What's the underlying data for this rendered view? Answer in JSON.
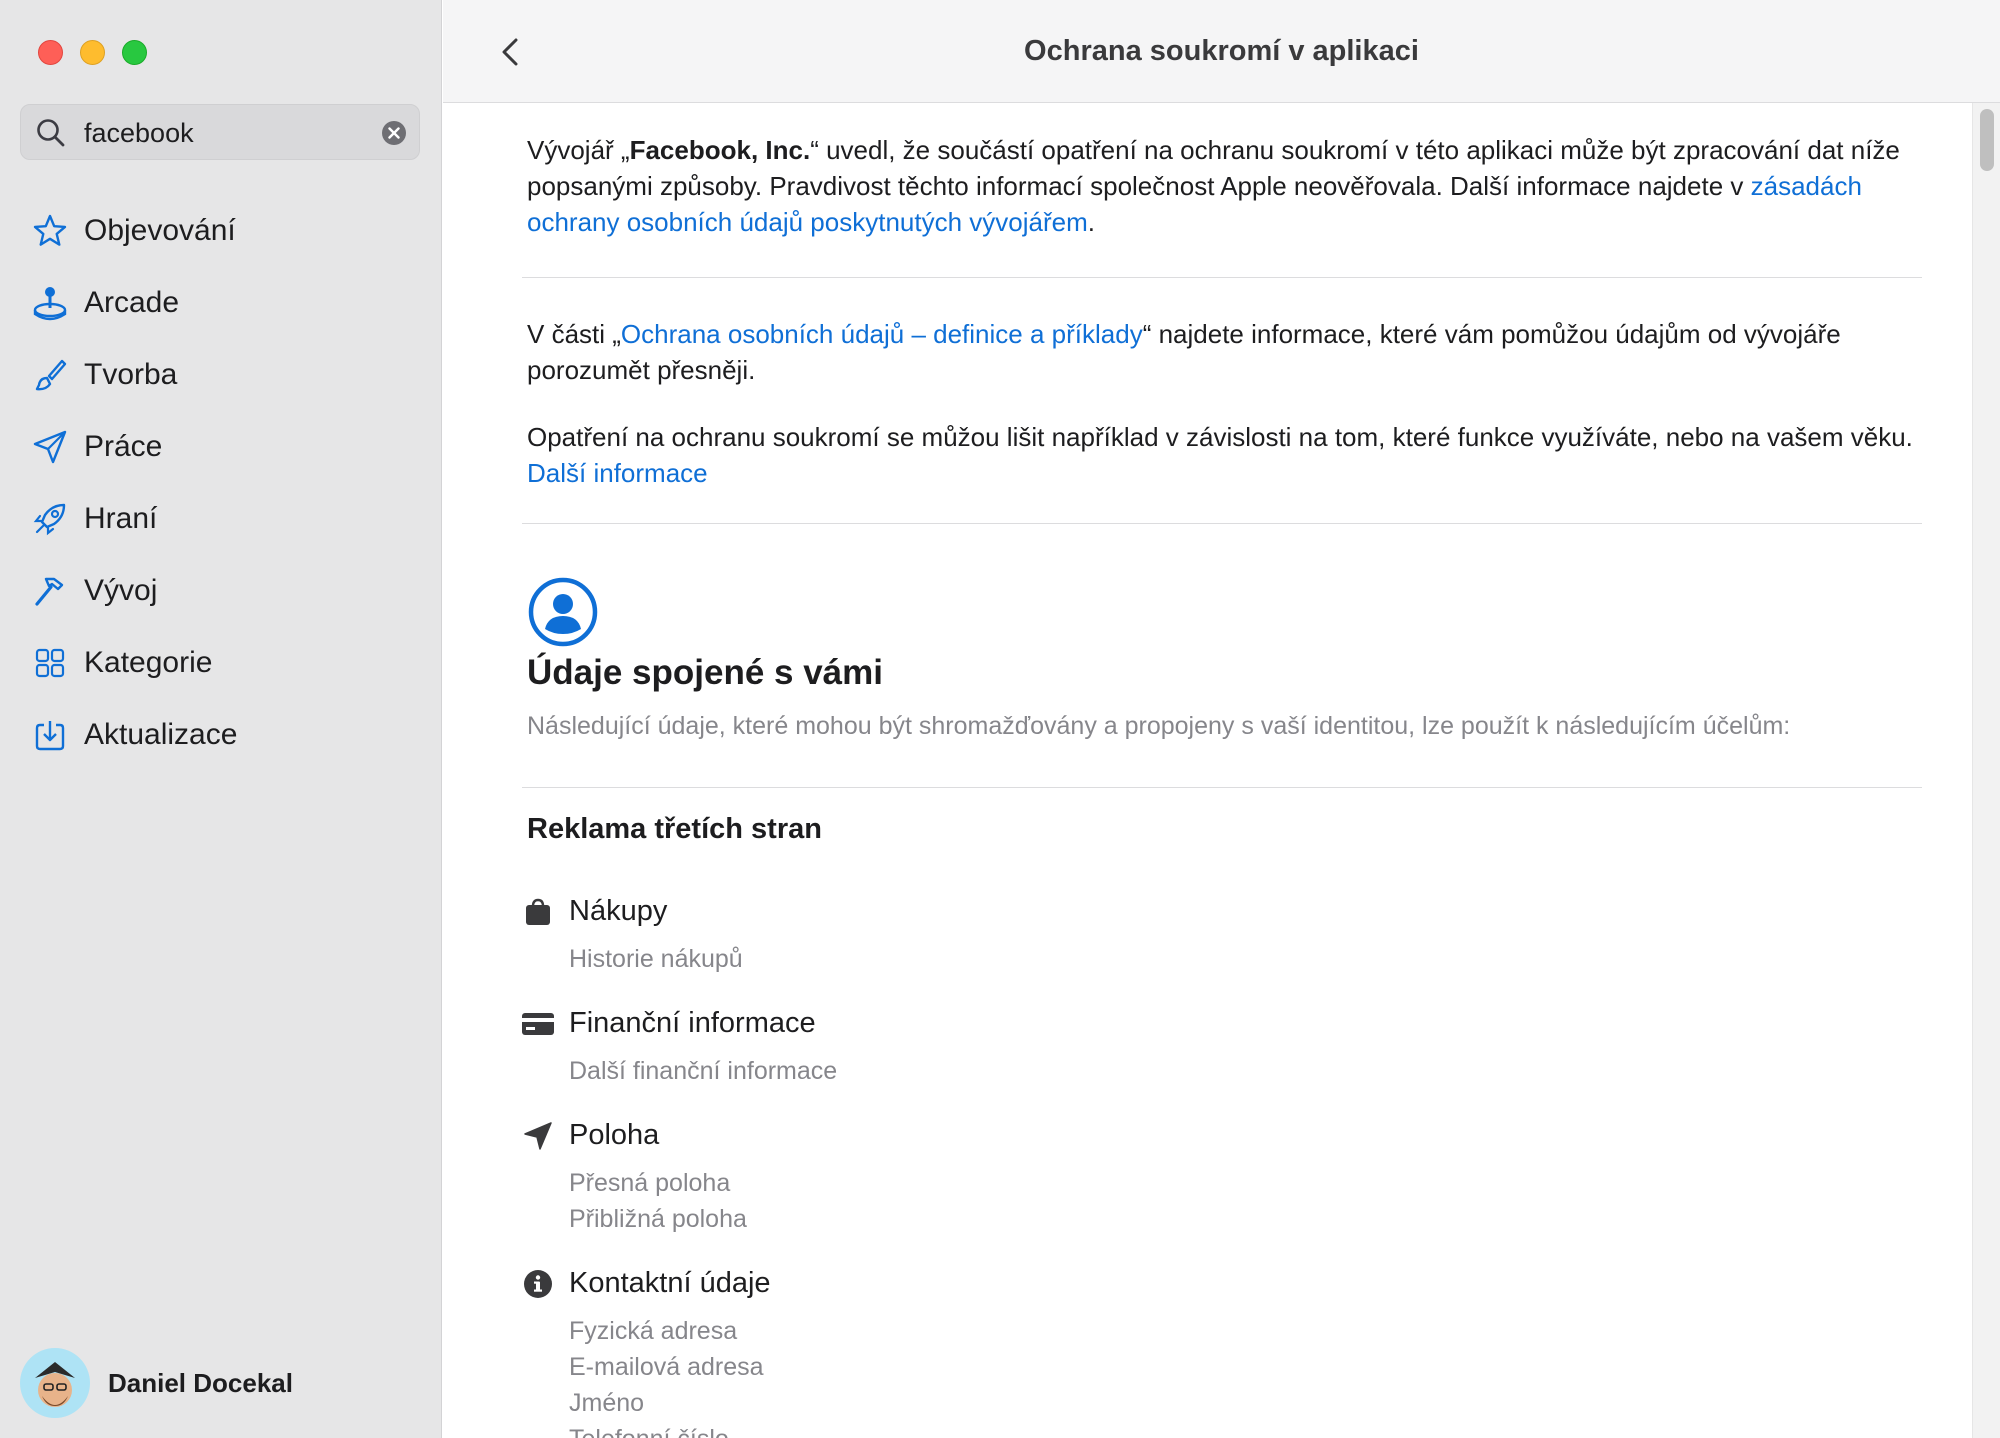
{
  "window": {
    "traffic_lights": [
      "close",
      "minimize",
      "maximize"
    ]
  },
  "sidebar": {
    "search": {
      "value": "facebook",
      "icon": "magnifier-icon",
      "clear_icon": "clear-circle-icon"
    },
    "items": [
      {
        "label": "Objevování",
        "icon": "star-icon"
      },
      {
        "label": "Arcade",
        "icon": "joystick-icon"
      },
      {
        "label": "Tvorba",
        "icon": "paintbrush-icon"
      },
      {
        "label": "Práce",
        "icon": "paperplane-icon"
      },
      {
        "label": "Hraní",
        "icon": "rocket-icon"
      },
      {
        "label": "Vývoj",
        "icon": "hammer-icon"
      },
      {
        "label": "Kategorie",
        "icon": "grid-icon"
      },
      {
        "label": "Aktualizace",
        "icon": "download-icon"
      }
    ],
    "user": {
      "name": "Daniel Docekal"
    }
  },
  "header": {
    "title": "Ochrana soukromí v aplikaci",
    "back_icon": "chevron-left-icon"
  },
  "content": {
    "intro": {
      "p1": "Vývojář „",
      "developer": "Facebook, Inc.",
      "p2": "“ uvedl, že součástí opatření na ochranu soukromí v této aplikaci může být zpracování dat níže popsanými způsoby. Pravdivost těchto informací společnost Apple neověřovala. Další informace najdete v ",
      "link": "zásadách ochrany osobních údajů poskytnutých vývojářem",
      "p3": "."
    },
    "definitions": {
      "p1": "V části „",
      "link": "Ochrana osobních údajů – definice a příklady",
      "p2": "“ najdete informace, které vám pomůžou údajům od vývojáře porozumět přesněji."
    },
    "variation": {
      "text": "Opatření na ochranu soukromí se můžou lišit například v závislosti na tom, které funkce využíváte, nebo na vašem věku. ",
      "link": "Další informace"
    },
    "section": {
      "icon": "person-circle-icon",
      "title": "Údaje spojené s vámi",
      "description": "Následující údaje, které mohou být shromažďovány a propojeny s vaší identitou, lze použít k následujícím účelům:",
      "purpose": "Reklama třetích stran",
      "categories": [
        {
          "title": "Nákupy",
          "icon": "shopping-bag-icon",
          "items": [
            "Historie nákupů"
          ]
        },
        {
          "title": "Finanční informace",
          "icon": "credit-card-icon",
          "items": [
            "Další finanční informace"
          ]
        },
        {
          "title": "Poloha",
          "icon": "location-arrow-icon",
          "items": [
            "Přesná poloha",
            "Přibližná poloha"
          ]
        },
        {
          "title": "Kontaktní údaje",
          "icon": "info-circle-icon",
          "items": [
            "Fyzická adresa",
            "E-mailová adresa",
            "Jméno",
            "Telefonní číslo"
          ]
        }
      ]
    }
  },
  "colors": {
    "accent": "#0f6fd6",
    "sidebar_bg": "#e6e6e7",
    "secondary_text": "#86868b"
  }
}
